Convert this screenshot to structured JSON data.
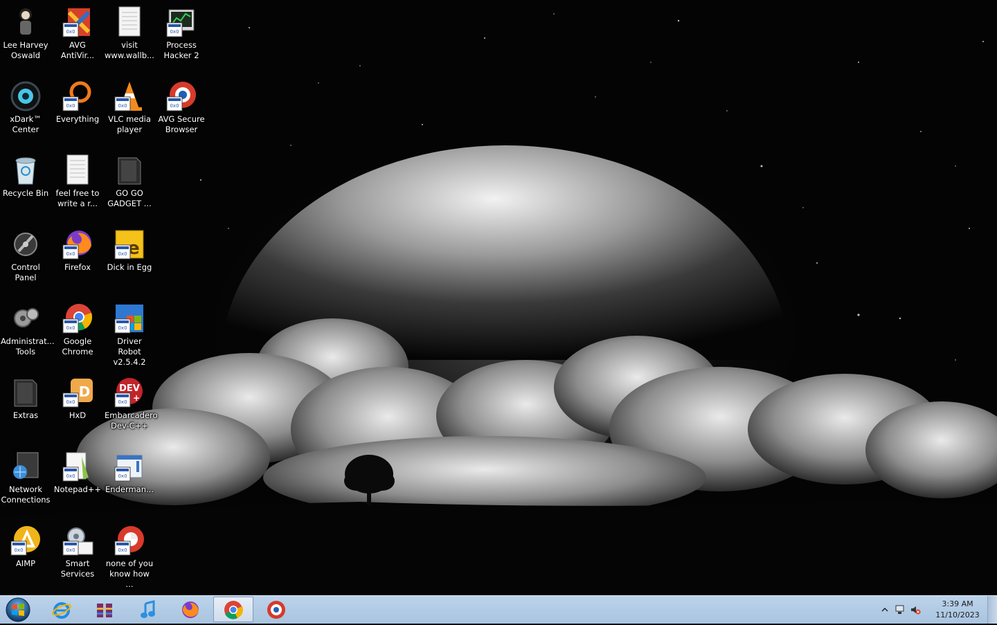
{
  "desktop": {
    "icons": [
      {
        "label": "Lee Harvey Oswald",
        "icon": "person-figure-icon"
      },
      {
        "label": "AVG AntiVir...",
        "icon": "avg-antivirus-icon"
      },
      {
        "label": "visit www.wallb...",
        "icon": "text-document-icon"
      },
      {
        "label": "Process Hacker 2",
        "icon": "process-hacker-icon"
      },
      {
        "label": "xDark™ Center",
        "icon": "xdark-center-icon"
      },
      {
        "label": "Everything",
        "icon": "everything-search-icon"
      },
      {
        "label": "VLC media player",
        "icon": "vlc-cone-icon"
      },
      {
        "label": "AVG Secure Browser",
        "icon": "avg-browser-icon"
      },
      {
        "label": "Recycle Bin",
        "icon": "recycle-bin-icon"
      },
      {
        "label": "feel free to write a r...",
        "icon": "text-document-icon"
      },
      {
        "label": "GO GO GADGET ...",
        "icon": "folder-dark-icon"
      },
      {
        "label": "Control Panel",
        "icon": "control-panel-icon"
      },
      {
        "label": "Firefox",
        "icon": "firefox-icon"
      },
      {
        "label": "Dick in Egg",
        "icon": "dick-in-egg-icon"
      },
      {
        "label": "Administrat... Tools",
        "icon": "admin-tools-icon"
      },
      {
        "label": "Google Chrome",
        "icon": "chrome-icon"
      },
      {
        "label": "Driver Robot v2.5.4.2",
        "icon": "driver-robot-icon"
      },
      {
        "label": "Extras",
        "icon": "folder-dark-icon"
      },
      {
        "label": "HxD",
        "icon": "hxd-icon"
      },
      {
        "label": "Embarcadero Dev-C++",
        "icon": "devcpp-icon"
      },
      {
        "label": "Network Connections",
        "icon": "network-connections-icon"
      },
      {
        "label": "Notepad++",
        "icon": "notepadpp-icon"
      },
      {
        "label": "Enderman...",
        "icon": "application-icon"
      },
      {
        "label": "AIMP",
        "icon": "aimp-icon"
      },
      {
        "label": "Smart Services",
        "icon": "smart-services-icon"
      },
      {
        "label": "none of you know how ...",
        "icon": "red-browser-icon"
      }
    ]
  },
  "taskbar": {
    "start": "start-orb-icon",
    "pinned": [
      {
        "name": "internet-explorer-icon",
        "active": false
      },
      {
        "name": "winrar-icon",
        "active": false
      },
      {
        "name": "itunes-icon",
        "active": false
      },
      {
        "name": "firefox-icon",
        "active": false
      },
      {
        "name": "chrome-icon",
        "active": true
      },
      {
        "name": "avg-browser-icon",
        "active": false
      }
    ],
    "tray": {
      "icons": [
        "show-hidden-icons-arrow",
        "network-icon",
        "volume-muted-icon"
      ],
      "time": "3:39 AM",
      "date": "11/10/2023"
    }
  },
  "colors": {
    "taskbar": "#b4cce6",
    "label_text": "#ffffff",
    "chrome_red": "#db4437",
    "chrome_green": "#0f9d58",
    "chrome_yellow": "#f4b400",
    "chrome_blue": "#4285f4"
  }
}
